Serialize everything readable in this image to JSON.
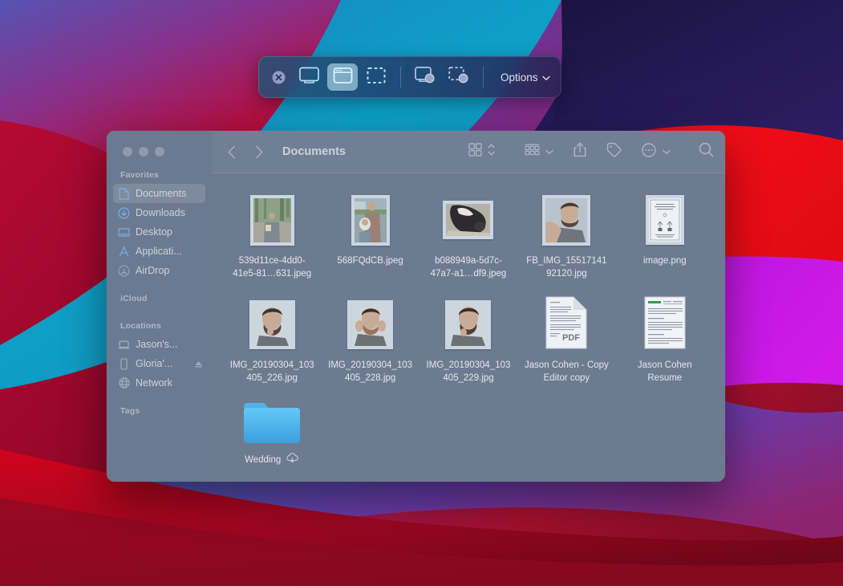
{
  "wallpaper": {
    "name": "macos-big-sur-wallpaper",
    "colors": [
      "#3f3f8f",
      "#5b4fa8",
      "#6a3fb0",
      "#1e8ebd",
      "#19123f",
      "#2a1a5e",
      "#e8141e",
      "#b8109a",
      "#c9197e",
      "#9b0f2e",
      "#7d0a22"
    ]
  },
  "screenshot_toolbar": {
    "name": "screenshot-capture-toolbar",
    "close_label": "Close",
    "buttons": [
      {
        "icon": "capture-entire-screen-icon",
        "label": "Capture Entire Screen",
        "active": false
      },
      {
        "icon": "capture-selected-window-icon",
        "label": "Capture Selected Window",
        "active": true
      },
      {
        "icon": "capture-selected-portion-icon",
        "label": "Capture Selected Portion",
        "active": false
      },
      {
        "icon": "record-entire-screen-icon",
        "label": "Record Entire Screen",
        "active": false
      },
      {
        "icon": "record-selected-portion-icon",
        "label": "Record Selected Portion",
        "active": false
      }
    ],
    "options_label": "Options",
    "options_chevron": "chevron-down-icon"
  },
  "finder": {
    "window_title": "Documents",
    "traffic_lights": [
      "close",
      "minimize",
      "zoom"
    ],
    "sidebar": {
      "sections": [
        {
          "header": "Favorites",
          "items": [
            {
              "label": "Documents",
              "icon": "document-icon",
              "selected": true
            },
            {
              "label": "Downloads",
              "icon": "downloads-icon",
              "selected": false
            },
            {
              "label": "Desktop",
              "icon": "desktop-icon",
              "selected": false
            },
            {
              "label": "Applicati...",
              "icon": "applications-icon",
              "selected": false
            },
            {
              "label": "AirDrop",
              "icon": "airdrop-icon",
              "selected": false
            }
          ]
        },
        {
          "header": "iCloud",
          "items": []
        },
        {
          "header": "Locations",
          "items": [
            {
              "label": "Jason's...",
              "icon": "laptop-icon",
              "selected": false
            },
            {
              "label": "Gloria'...",
              "icon": "iphone-icon",
              "selected": false,
              "eject": true
            },
            {
              "label": "Network",
              "icon": "globe-icon",
              "selected": false
            }
          ]
        },
        {
          "header": "Tags",
          "items": []
        }
      ]
    },
    "toolbar": {
      "back_icon": "chevron-left-icon",
      "forward_icon": "chevron-right-icon",
      "view_icon": "icon-view-icon",
      "view_chevron": "sort-updown-icon",
      "group_icon": "group-by-icon",
      "group_chevron": "chevron-down-icon",
      "share_icon": "share-icon",
      "tag_icon": "tag-icon",
      "more_icon": "more-ellipsis-icon",
      "more_chevron": "chevron-down-icon",
      "search_icon": "search-icon"
    },
    "files": [
      {
        "name": "539d11ce-4dd0-41e5-81…631.jpeg",
        "kind": "photo",
        "thumb": "portrait-forest"
      },
      {
        "name": "568FQdCB.jpeg",
        "kind": "photo",
        "thumb": "portrait-baby"
      },
      {
        "name": "b088949a-5d7c-47a7-a1…df9.jpeg",
        "kind": "photo",
        "thumb": "landscape-dog"
      },
      {
        "name": "FB_IMG_15517141 92120.jpg",
        "kind": "photo",
        "thumb": "portrait-man"
      },
      {
        "name": "image.png",
        "kind": "photo",
        "thumb": "document-scan"
      },
      {
        "name": "IMG_20190304_103405_226.jpg",
        "kind": "photo",
        "thumb": "portrait-thinking"
      },
      {
        "name": "IMG_20190304_103405_228.jpg",
        "kind": "photo",
        "thumb": "portrait-hands"
      },
      {
        "name": "IMG_20190304_103405_229.jpg",
        "kind": "photo",
        "thumb": "portrait-chin"
      },
      {
        "name": "Jason Cohen - Copy Editor copy",
        "kind": "pdf",
        "badge": "PDF"
      },
      {
        "name": "Jason Cohen Resume",
        "kind": "doc"
      },
      {
        "name": "Wedding",
        "kind": "folder",
        "cloud_badge": "icloud-download-icon"
      }
    ]
  }
}
